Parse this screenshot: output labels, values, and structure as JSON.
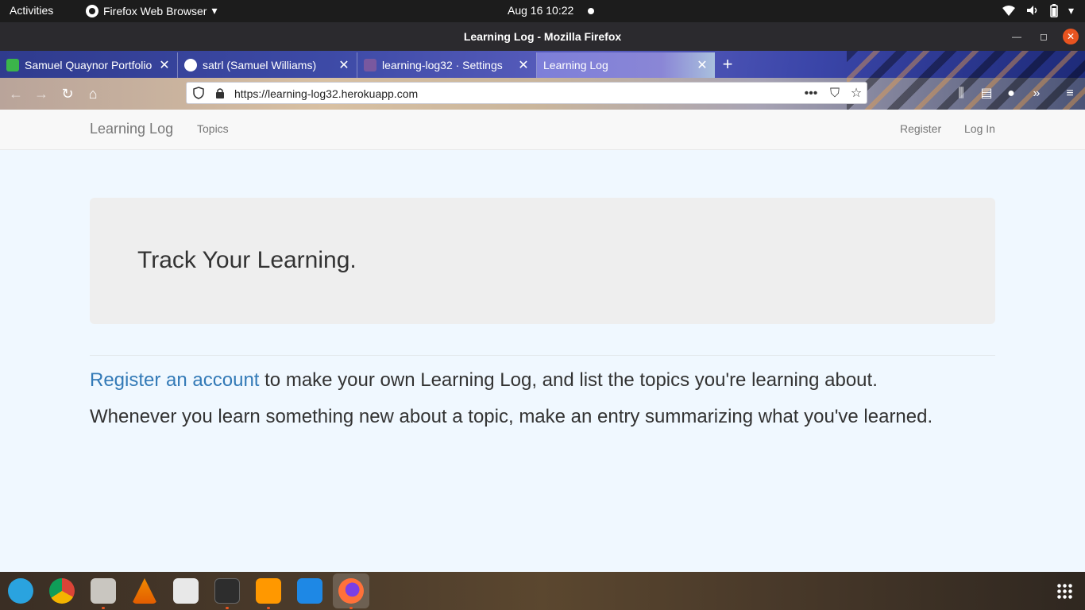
{
  "system_bar": {
    "activities": "Activities",
    "app_name": "Firefox Web Browser",
    "clock": "Aug 16  10:22"
  },
  "window": {
    "title": "Learning Log - Mozilla Firefox"
  },
  "tabs": [
    {
      "label": "Samuel Quaynor Portfolio",
      "active": false,
      "favicon_color": "#3bb54a"
    },
    {
      "label": "satrl (Samuel Williams)",
      "active": false,
      "favicon_color": "#ffffff"
    },
    {
      "label": "learning-log32 · Settings",
      "active": false,
      "favicon_color": "#79589f"
    },
    {
      "label": "Learning Log",
      "active": true,
      "favicon_color": ""
    }
  ],
  "urlbar": {
    "url": "https://learning-log32.herokuapp.com"
  },
  "site": {
    "brand": "Learning Log",
    "nav_left": [
      "Topics"
    ],
    "nav_right": [
      "Register",
      "Log In"
    ],
    "jumbotron_heading": "Track Your Learning.",
    "para1_link": "Register an account",
    "para1_rest": " to make your own Learning Log, and list the topics you're learning about.",
    "para2": "Whenever you learn something new about a topic, make an entry summarizing what you've learned."
  },
  "colors": {
    "page_bg": "#f0f8ff",
    "link": "#337ab7",
    "jumbotron_bg": "#eeeeee",
    "close_button": "#e95420"
  },
  "dock": {
    "apps": [
      "telegram-icon",
      "chrome-icon",
      "files-icon",
      "vlc-icon",
      "text-editor-icon",
      "terminal-icon",
      "sublime-text-icon",
      "vscode-icon",
      "firefox-icon"
    ]
  }
}
